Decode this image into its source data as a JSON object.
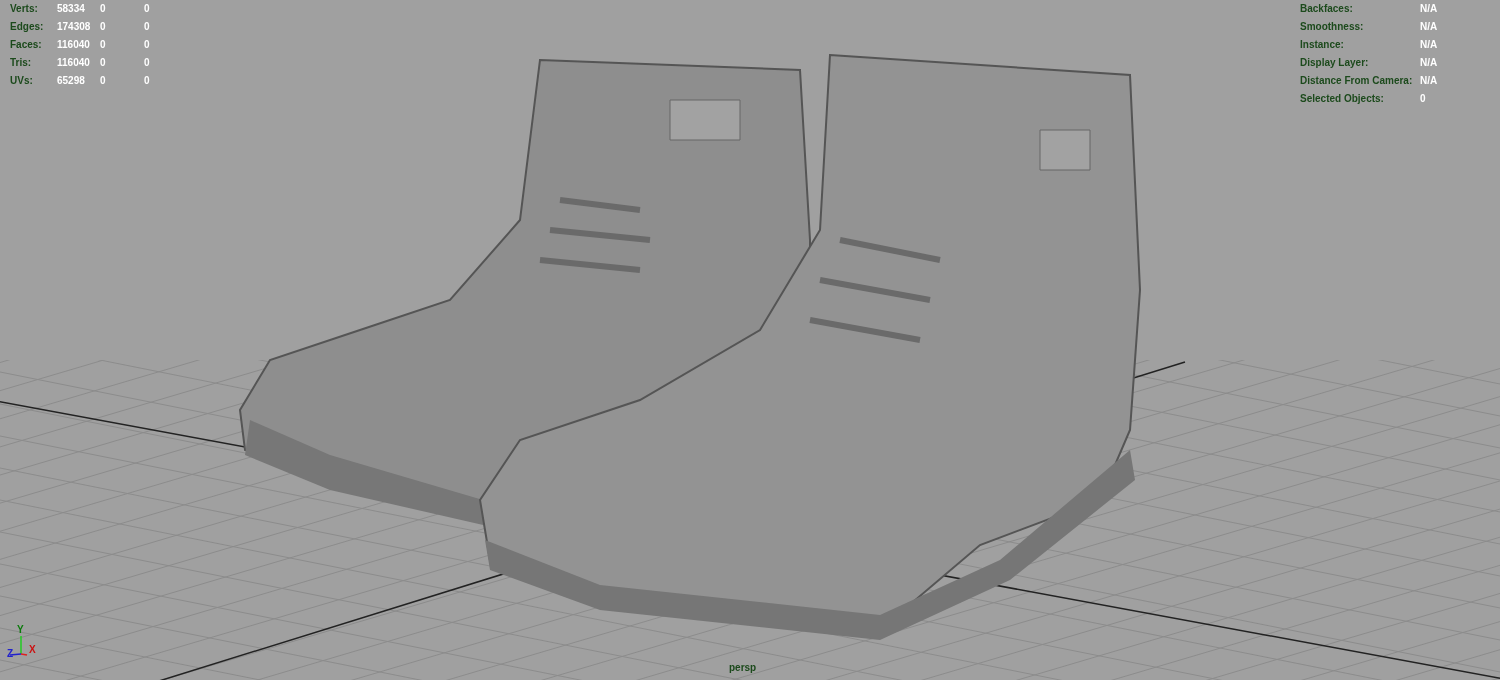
{
  "poly_count": [
    {
      "label": "Verts:",
      "values": [
        "58334",
        "0",
        "0"
      ]
    },
    {
      "label": "Edges:",
      "values": [
        "174308",
        "0",
        "0"
      ]
    },
    {
      "label": "Faces:",
      "values": [
        "116040",
        "0",
        "0"
      ]
    },
    {
      "label": "Tris:",
      "values": [
        "116040",
        "0",
        "0"
      ]
    },
    {
      "label": "UVs:",
      "values": [
        "65298",
        "0",
        "0"
      ]
    }
  ],
  "object_details": [
    {
      "label": "Backfaces:",
      "value": "N/A"
    },
    {
      "label": "Smoothness:",
      "value": "N/A"
    },
    {
      "label": "Instance:",
      "value": "N/A"
    },
    {
      "label": "Display Layer:",
      "value": "N/A"
    },
    {
      "label": "Distance From Camera:",
      "value": "N/A"
    },
    {
      "label": "Selected Objects:",
      "value": "0"
    }
  ],
  "axis_gizmo": {
    "x": "X",
    "y": "Y",
    "z": "Z"
  },
  "camera": "persp"
}
